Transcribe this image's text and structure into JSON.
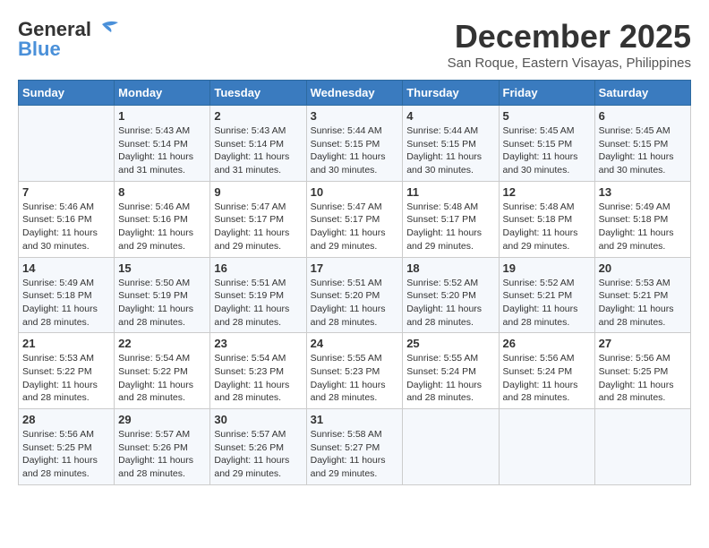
{
  "header": {
    "logo_line1": "General",
    "logo_line2": "Blue",
    "month": "December 2025",
    "location": "San Roque, Eastern Visayas, Philippines"
  },
  "days_of_week": [
    "Sunday",
    "Monday",
    "Tuesday",
    "Wednesday",
    "Thursday",
    "Friday",
    "Saturday"
  ],
  "weeks": [
    [
      {
        "day": "",
        "info": ""
      },
      {
        "day": "1",
        "info": "Sunrise: 5:43 AM\nSunset: 5:14 PM\nDaylight: 11 hours\nand 31 minutes."
      },
      {
        "day": "2",
        "info": "Sunrise: 5:43 AM\nSunset: 5:14 PM\nDaylight: 11 hours\nand 31 minutes."
      },
      {
        "day": "3",
        "info": "Sunrise: 5:44 AM\nSunset: 5:15 PM\nDaylight: 11 hours\nand 30 minutes."
      },
      {
        "day": "4",
        "info": "Sunrise: 5:44 AM\nSunset: 5:15 PM\nDaylight: 11 hours\nand 30 minutes."
      },
      {
        "day": "5",
        "info": "Sunrise: 5:45 AM\nSunset: 5:15 PM\nDaylight: 11 hours\nand 30 minutes."
      },
      {
        "day": "6",
        "info": "Sunrise: 5:45 AM\nSunset: 5:15 PM\nDaylight: 11 hours\nand 30 minutes."
      }
    ],
    [
      {
        "day": "7",
        "info": "Sunrise: 5:46 AM\nSunset: 5:16 PM\nDaylight: 11 hours\nand 30 minutes."
      },
      {
        "day": "8",
        "info": "Sunrise: 5:46 AM\nSunset: 5:16 PM\nDaylight: 11 hours\nand 29 minutes."
      },
      {
        "day": "9",
        "info": "Sunrise: 5:47 AM\nSunset: 5:17 PM\nDaylight: 11 hours\nand 29 minutes."
      },
      {
        "day": "10",
        "info": "Sunrise: 5:47 AM\nSunset: 5:17 PM\nDaylight: 11 hours\nand 29 minutes."
      },
      {
        "day": "11",
        "info": "Sunrise: 5:48 AM\nSunset: 5:17 PM\nDaylight: 11 hours\nand 29 minutes."
      },
      {
        "day": "12",
        "info": "Sunrise: 5:48 AM\nSunset: 5:18 PM\nDaylight: 11 hours\nand 29 minutes."
      },
      {
        "day": "13",
        "info": "Sunrise: 5:49 AM\nSunset: 5:18 PM\nDaylight: 11 hours\nand 29 minutes."
      }
    ],
    [
      {
        "day": "14",
        "info": "Sunrise: 5:49 AM\nSunset: 5:18 PM\nDaylight: 11 hours\nand 28 minutes."
      },
      {
        "day": "15",
        "info": "Sunrise: 5:50 AM\nSunset: 5:19 PM\nDaylight: 11 hours\nand 28 minutes."
      },
      {
        "day": "16",
        "info": "Sunrise: 5:51 AM\nSunset: 5:19 PM\nDaylight: 11 hours\nand 28 minutes."
      },
      {
        "day": "17",
        "info": "Sunrise: 5:51 AM\nSunset: 5:20 PM\nDaylight: 11 hours\nand 28 minutes."
      },
      {
        "day": "18",
        "info": "Sunrise: 5:52 AM\nSunset: 5:20 PM\nDaylight: 11 hours\nand 28 minutes."
      },
      {
        "day": "19",
        "info": "Sunrise: 5:52 AM\nSunset: 5:21 PM\nDaylight: 11 hours\nand 28 minutes."
      },
      {
        "day": "20",
        "info": "Sunrise: 5:53 AM\nSunset: 5:21 PM\nDaylight: 11 hours\nand 28 minutes."
      }
    ],
    [
      {
        "day": "21",
        "info": "Sunrise: 5:53 AM\nSunset: 5:22 PM\nDaylight: 11 hours\nand 28 minutes."
      },
      {
        "day": "22",
        "info": "Sunrise: 5:54 AM\nSunset: 5:22 PM\nDaylight: 11 hours\nand 28 minutes."
      },
      {
        "day": "23",
        "info": "Sunrise: 5:54 AM\nSunset: 5:23 PM\nDaylight: 11 hours\nand 28 minutes."
      },
      {
        "day": "24",
        "info": "Sunrise: 5:55 AM\nSunset: 5:23 PM\nDaylight: 11 hours\nand 28 minutes."
      },
      {
        "day": "25",
        "info": "Sunrise: 5:55 AM\nSunset: 5:24 PM\nDaylight: 11 hours\nand 28 minutes."
      },
      {
        "day": "26",
        "info": "Sunrise: 5:56 AM\nSunset: 5:24 PM\nDaylight: 11 hours\nand 28 minutes."
      },
      {
        "day": "27",
        "info": "Sunrise: 5:56 AM\nSunset: 5:25 PM\nDaylight: 11 hours\nand 28 minutes."
      }
    ],
    [
      {
        "day": "28",
        "info": "Sunrise: 5:56 AM\nSunset: 5:25 PM\nDaylight: 11 hours\nand 28 minutes."
      },
      {
        "day": "29",
        "info": "Sunrise: 5:57 AM\nSunset: 5:26 PM\nDaylight: 11 hours\nand 28 minutes."
      },
      {
        "day": "30",
        "info": "Sunrise: 5:57 AM\nSunset: 5:26 PM\nDaylight: 11 hours\nand 29 minutes."
      },
      {
        "day": "31",
        "info": "Sunrise: 5:58 AM\nSunset: 5:27 PM\nDaylight: 11 hours\nand 29 minutes."
      },
      {
        "day": "",
        "info": ""
      },
      {
        "day": "",
        "info": ""
      },
      {
        "day": "",
        "info": ""
      }
    ]
  ]
}
